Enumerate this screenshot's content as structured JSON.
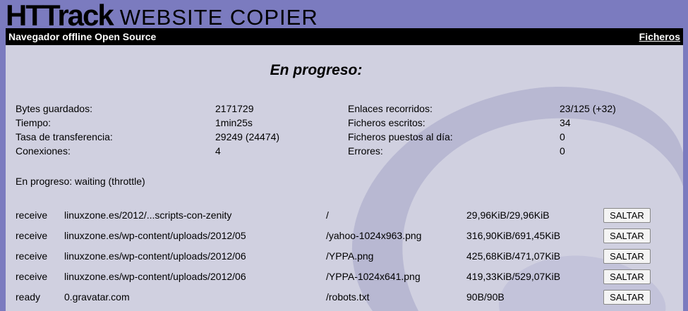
{
  "header": {
    "logo_main": "HTTrack",
    "logo_sub": "WEBSITE COPIER",
    "subtitle": "Navegador offline Open Source",
    "files_link": "Ficheros"
  },
  "main": {
    "title": "En progreso:",
    "stats": [
      {
        "label": "Bytes guardados:",
        "value": "2171729",
        "label2": "Enlaces recorridos:",
        "value2": "23/125 (+32)"
      },
      {
        "label": "Tiempo:",
        "value": "1min25s",
        "label2": "Ficheros escritos:",
        "value2": "34"
      },
      {
        "label": "Tasa de transferencia:",
        "value": "29249 (24474)",
        "label2": "Ficheros puestos al día:",
        "value2": "0"
      },
      {
        "label": "Conexiones:",
        "value": "4",
        "label2": "Errores:",
        "value2": "0"
      }
    ],
    "status": "En progreso: waiting (throttle)",
    "transfers": [
      {
        "state": "receive",
        "host": "linuxzone.es/2012/...scripts-con-zenity",
        "file": "/",
        "size": "29,96KiB/29,96KiB",
        "button": "SALTAR"
      },
      {
        "state": "receive",
        "host": "linuxzone.es/wp-content/uploads/2012/05",
        "file": "/yahoo-1024x963.png",
        "size": "316,90KiB/691,45KiB",
        "button": "SALTAR"
      },
      {
        "state": "receive",
        "host": "linuxzone.es/wp-content/uploads/2012/06",
        "file": "/YPPA.png",
        "size": "425,68KiB/471,07KiB",
        "button": "SALTAR"
      },
      {
        "state": "receive",
        "host": "linuxzone.es/wp-content/uploads/2012/06",
        "file": "/YPPA-1024x641.png",
        "size": "419,33KiB/529,07KiB",
        "button": "SALTAR"
      },
      {
        "state": "ready",
        "host": "0.gravatar.com",
        "file": "/robots.txt",
        "size": "90B/90B",
        "button": "SALTAR"
      }
    ]
  },
  "colors": {
    "page_bg": "#7b7bbf",
    "panel_bg": "#d0d0e0",
    "swirl": "#b8b8d2",
    "topbar_bg": "#000000"
  }
}
